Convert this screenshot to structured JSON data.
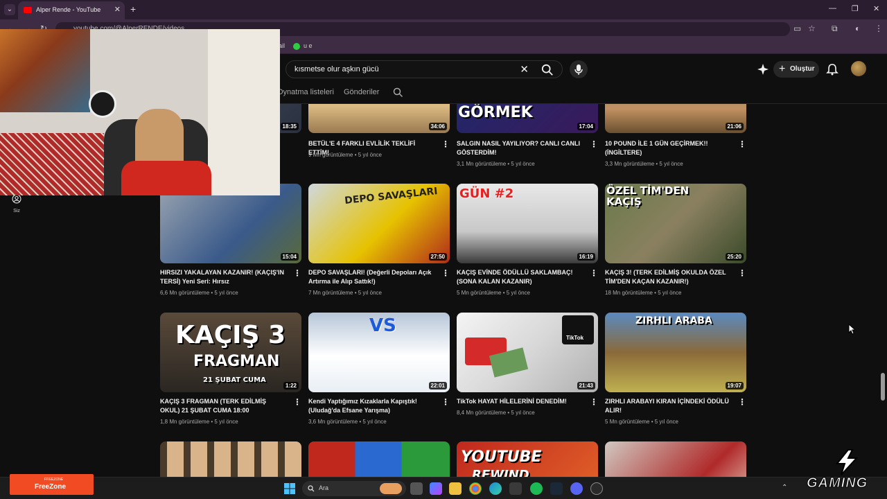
{
  "browser": {
    "tab_title": "Alper Rende - YouTube",
    "tab_close": "✕",
    "new_tab": "+",
    "url": "youtube.com/@AlperRENDE/videos",
    "bookmarks": [
      "ail",
      "u e"
    ]
  },
  "youtube": {
    "search_query": "kısmetse olur aşkın gücü",
    "create_label": "Oluştur",
    "channel_tabs": [
      "Oynatma listeleri",
      "Gönderiler"
    ],
    "sidebar_you": "Siz"
  },
  "videos": [
    {
      "title": "",
      "duration": "18:35",
      "views": "",
      "age": ""
    },
    {
      "title": "BETÜL'E 4 FARKLI EVLİLİK TEKLİFİ ETTİM!",
      "duration": "34:06",
      "views": "9 Mn görüntüleme",
      "age": "5 yıl önce"
    },
    {
      "title": "SALGIN NASIL YAYILIYOR? CANLI CANLI GÖSTERDİM!",
      "duration": "17:04",
      "views": "3,1 Mn görüntüleme",
      "age": "5 yıl önce",
      "thumb_text": "GÖRMEK"
    },
    {
      "title": "10 POUND İLE 1 GÜN GEÇİRMEK!! (İNGİLTERE)",
      "duration": "21:06",
      "views": "3,3 Mn görüntüleme",
      "age": "5 yıl önce"
    },
    {
      "title": "HIRSIZI YAKALAYAN KAZANIR! (KAÇIŞ'IN TERSİ) Yeni Seri: Hırsız",
      "duration": "15:04",
      "views": "6,6 Mn görüntüleme",
      "age": "5 yıl önce"
    },
    {
      "title": "DEPO SAVAŞLARI! (Değerli Depoları Açık Artırma ile Alıp Sattık!)",
      "duration": "27:50",
      "views": "7 Mn görüntüleme",
      "age": "5 yıl önce",
      "thumb_text": "DEPO SAVAŞLARI"
    },
    {
      "title": "KAÇIŞ EVİNDE ÖDÜLLÜ SAKLAMBAÇ! (SONA KALAN KAZANIR)",
      "duration": "16:19",
      "views": "5 Mn görüntüleme",
      "age": "5 yıl önce",
      "thumb_text": "GÜN #2"
    },
    {
      "title": "KAÇIŞ 3! (TERK EDİLMİŞ OKULDA ÖZEL TİM'DEN KAÇAN KAZANIR!)",
      "duration": "25:20",
      "views": "18 Mn görüntüleme",
      "age": "5 yıl önce",
      "thumb_text": "ÖZEL TİM'DEN KAÇIŞ"
    },
    {
      "title": "KAÇIŞ 3 FRAGMAN (TERK EDİLMİŞ OKUL) 21 ŞUBAT CUMA 18:00",
      "duration": "1:22",
      "views": "1,8 Mn görüntüleme",
      "age": "5 yıl önce",
      "thumb_text": "KAÇIŞ 3",
      "thumb_text2": "FRAGMAN",
      "thumb_text3": "21 ŞUBAT CUMA"
    },
    {
      "title": "Kendi Yaptığımız Kızaklarla Kapıştık! (Uludağ'da Efsane Yarışma)",
      "duration": "22:01",
      "views": "3,6 Mn görüntüleme",
      "age": "5 yıl önce",
      "thumb_text": "VS"
    },
    {
      "title": "TikTok HAYAT HİLELERİNİ DENEDİM!",
      "duration": "21:43",
      "views": "8,4 Mn görüntüleme",
      "age": "5 yıl önce",
      "thumb_text": "TikTok"
    },
    {
      "title": "ZIRHLI ARABAYI KIRAN İÇİNDEKİ ÖDÜLÜ ALIR!",
      "duration": "19:07",
      "views": "5 Mn görüntüleme",
      "age": "5 yıl önce",
      "thumb_text": "ZIRHLI ARABA"
    },
    {
      "title": "",
      "duration": "",
      "views": "",
      "age": ""
    },
    {
      "title": "",
      "duration": "",
      "views": "",
      "age": ""
    },
    {
      "title": "",
      "duration": "",
      "views": "",
      "age": "",
      "thumb_text": "YOUTUBE",
      "thumb_text2": "REWIND"
    },
    {
      "title": "",
      "duration": "",
      "views": "",
      "age": ""
    }
  ],
  "taskbar": {
    "search_label": "Ara"
  },
  "overlay": {
    "freezone_small": "FREEZONE",
    "freezone": "FreeZone",
    "gaming": "GAMING"
  },
  "colors": {
    "youtube_red": "#ff0000",
    "browser_frame": "#3d2c43",
    "page_bg": "#0f0f0f",
    "freezone_orange": "#f04b23"
  }
}
